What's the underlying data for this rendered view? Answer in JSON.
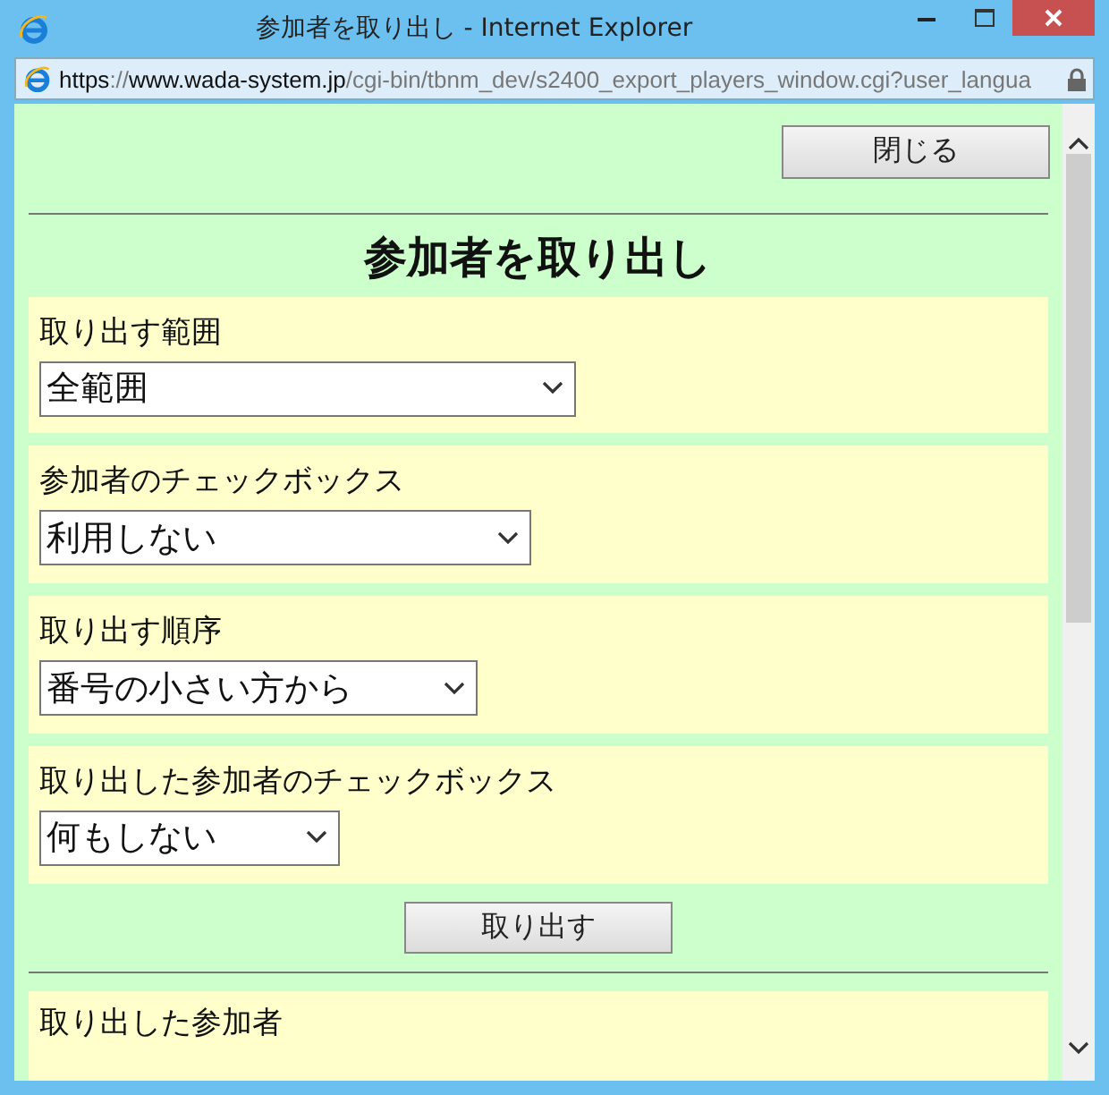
{
  "window": {
    "title": "参加者を取り出し - Internet Explorer"
  },
  "address_bar": {
    "parts": [
      {
        "text": "https",
        "kind": "strong"
      },
      {
        "text": "://",
        "kind": "dim"
      },
      {
        "text": "www.wada-system.jp",
        "kind": "strong"
      },
      {
        "text": "/cgi-bin/tbnm_dev/s2400_export_players_window.cgi?user_langua",
        "kind": "dim"
      }
    ]
  },
  "close_button": "閉じる",
  "heading": "参加者を取り出し",
  "fields": [
    {
      "label": "取り出す範囲",
      "value": "全範囲"
    },
    {
      "label": "参加者のチェックボックス",
      "value": "利用しない"
    },
    {
      "label": "取り出す順序",
      "value": "番号の小さい方から"
    },
    {
      "label": "取り出した参加者のチェックボックス",
      "value": "何もしない"
    }
  ],
  "export_button": "取り出す",
  "result_section": {
    "label": "取り出した参加者"
  }
}
